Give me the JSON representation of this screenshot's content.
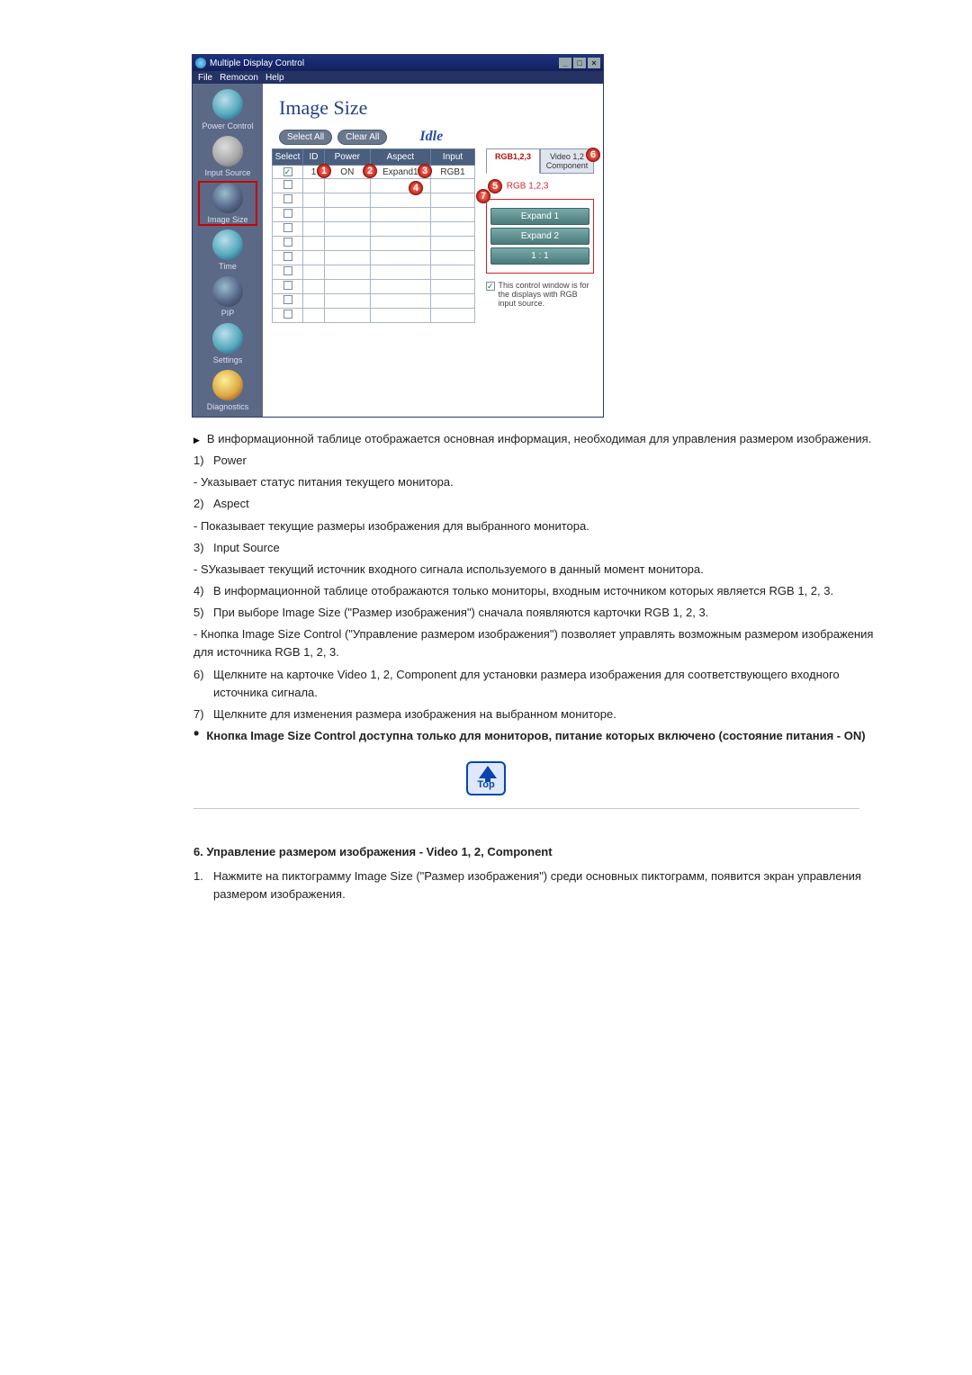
{
  "app_window": {
    "title": "Multiple Display Control",
    "menu": {
      "file": "File",
      "remocon": "Remocon",
      "help": "Help"
    },
    "sidebar": [
      {
        "name": "power-control",
        "label": "Power Control",
        "iconClass": ""
      },
      {
        "name": "input-source",
        "label": "Input Source",
        "iconClass": "gray"
      },
      {
        "name": "image-size",
        "label": "Image Size",
        "iconClass": "dark",
        "selected": true
      },
      {
        "name": "time",
        "label": "Time",
        "iconClass": ""
      },
      {
        "name": "pip",
        "label": "PIP",
        "iconClass": "dark"
      },
      {
        "name": "settings",
        "label": "Settings",
        "iconClass": ""
      },
      {
        "name": "diagnostics",
        "label": "Diagnostics",
        "iconClass": "gold"
      }
    ],
    "panel_title": "Image Size",
    "buttons": {
      "select_all": "Select All",
      "clear_all": "Clear All"
    },
    "idle": "Idle",
    "columns": {
      "select": "Select",
      "id": "ID",
      "power": "Power",
      "aspect": "Aspect",
      "input": "Input"
    },
    "row1": {
      "id": "1",
      "power": "ON",
      "aspect": "Expand1",
      "input": "RGB1"
    },
    "tabs": {
      "rgb": "RGB1,2,3",
      "video": "Video 1,2 Component"
    },
    "subtab_text": "RGB 1,2,3",
    "options": {
      "expand1": "Expand 1",
      "expand2": "Expand 2",
      "oneone": "1 : 1"
    },
    "note": "This control window is for the displays with RGB input source."
  },
  "markers": {
    "1": "1",
    "2": "2",
    "3": "3",
    "4": "4",
    "5": "5",
    "6": "6",
    "7": "7"
  },
  "text": {
    "bullet_top": "В информационной таблице отображается основная информация, необходимая для управления размером изображения.",
    "p1_head": "Power",
    "p1_body": "- Указывает статус питания текущего монитора.",
    "p2_head": "Aspect",
    "p2_body": "- Показывает текущие размеры изображения для выбранного монитора.",
    "p3_head": "Input Source",
    "p3_body": "- SУказывает текущий источник входного сигнала используемого в данный момент монитора.",
    "p4": "В информационной таблице отображаются только мониторы, входным источником которых является RGB 1, 2, 3.",
    "p5": "При выборе Image Size (\"Размер изображения\") сначала появляются карточки RGB 1, 2, 3.",
    "p5_sub": "- Кнопка Image Size Control (\"Управление размером изображения\") позволяет управлять возможным размером изображения для источника RGB 1, 2, 3.",
    "p6": "Щелкните на карточке Video 1, 2, Component для установки размера изображения для соответствующего входного источника сигнала.",
    "p7": "Щелкните для изменения размера изображения на выбранном мониторе.",
    "note_bold": "Кнопка Image Size Control доступна только для мониторов, питание которых включено (состояние питания - ON)",
    "top_btn": "Top",
    "section6_head": "6. Управление размером изображения - Video 1, 2, Component",
    "section6_item1_num": "1.",
    "section6_item1": "Нажмите на пиктограмму Image Size (\"Размер изображения\") среди основных пиктограмм, появится экран управления размером изображения.",
    "nums": {
      "n1": "1)",
      "n2": "2)",
      "n3": "3)",
      "n4": "4)",
      "n5": "5)",
      "n6": "6)",
      "n7": "7)"
    }
  }
}
